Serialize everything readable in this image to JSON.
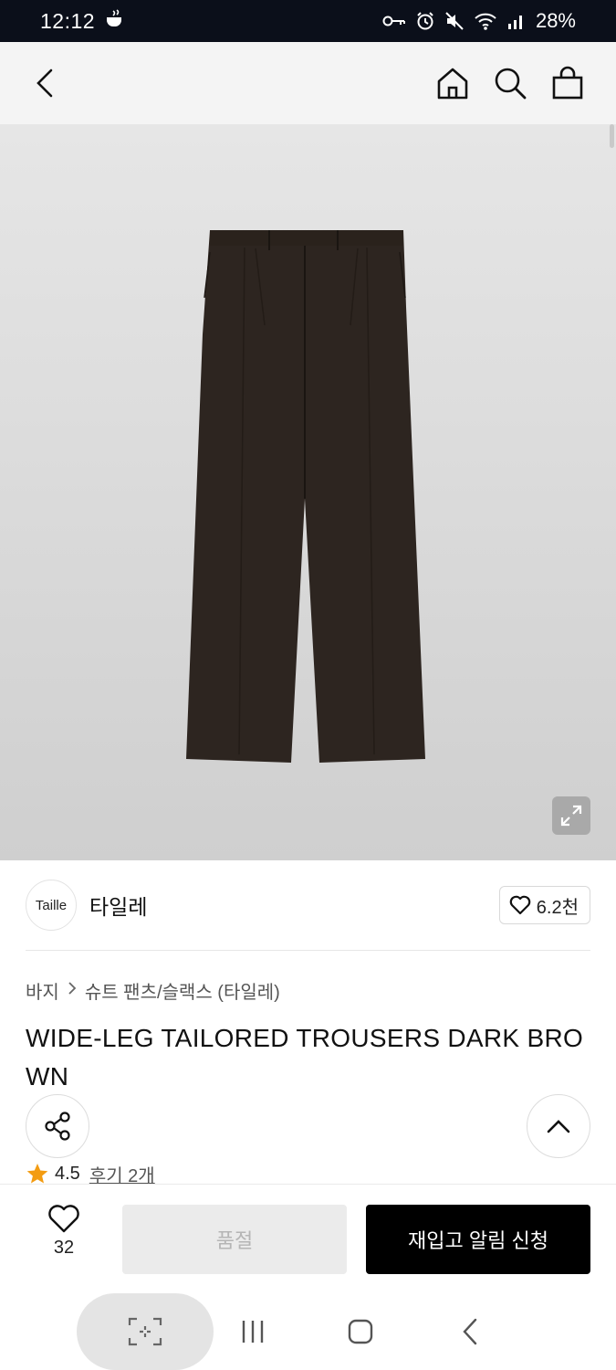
{
  "status_bar": {
    "time": "12:12",
    "battery": "28%",
    "icons": [
      "coffee-icon",
      "key-icon",
      "alarm-icon",
      "mute-icon",
      "wifi-icon",
      "signal-icon"
    ]
  },
  "header": {
    "icons": [
      "chevron-left-icon",
      "home-icon",
      "search-icon",
      "shopping-bag-icon"
    ]
  },
  "product_image": {
    "alt": "dark brown wide-leg trousers",
    "expand_icon": "expand-icon"
  },
  "brand": {
    "logo_text": "Taille",
    "name": "타일레",
    "like_count": "6.2천"
  },
  "breadcrumb": {
    "items": [
      "바지",
      "슈트 팬츠/슬랙스 (타일레)"
    ]
  },
  "product": {
    "title": "WIDE-LEG TAILORED TROUSERS DARK BROWN",
    "rating": "4.5",
    "reviews": "후기 2개"
  },
  "bottom_bar": {
    "wish_count": "32",
    "soldout_label": "품절",
    "restock_label": "재입고 알림 신청"
  },
  "colors": {
    "image_bg_top": "#e6e6e6",
    "image_bg_bottom": "#cfcfcf",
    "trouser": "#2d2520",
    "star": "#f39c12",
    "primary_button": "#000000",
    "disabled_button": "#ebebeb"
  }
}
